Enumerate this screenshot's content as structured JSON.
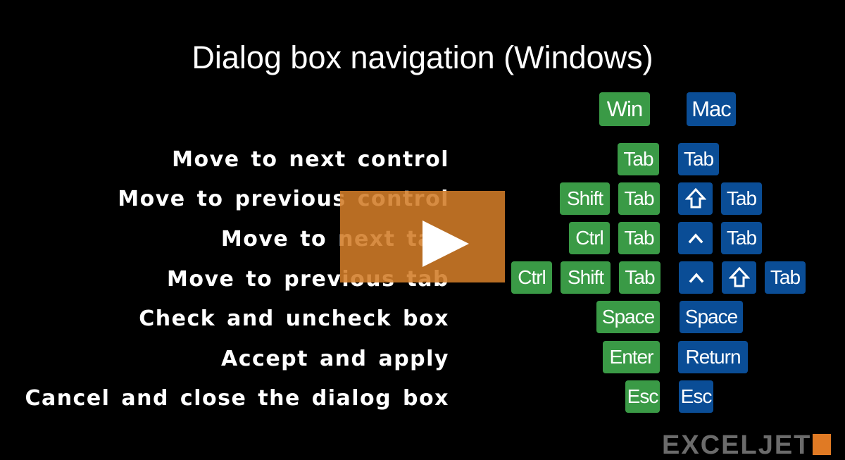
{
  "title": "Dialog box navigation (Windows)",
  "columns": {
    "win_label": "Win",
    "mac_label": "Mac"
  },
  "colors": {
    "win_key": "#3a9a46",
    "mac_key": "#0a4d96",
    "play_overlay": "#d17c28",
    "background": "#000000"
  },
  "rows": [
    {
      "description": "Move to next control",
      "win_keys": [
        "Tab"
      ],
      "mac_keys": [
        "Tab"
      ]
    },
    {
      "description": "Move to previous control",
      "win_keys": [
        "Shift",
        "Tab"
      ],
      "mac_keys": [
        "shift-arrow-icon",
        "Tab"
      ]
    },
    {
      "description": "Move to next tab",
      "win_keys": [
        "Ctrl",
        "Tab"
      ],
      "mac_keys": [
        "control-caret-icon",
        "Tab"
      ]
    },
    {
      "description": "Move to previous tab",
      "win_keys": [
        "Ctrl",
        "Shift",
        "Tab"
      ],
      "mac_keys": [
        "control-caret-icon",
        "shift-arrow-icon",
        "Tab"
      ]
    },
    {
      "description": "Check and uncheck box",
      "win_keys": [
        "Space"
      ],
      "mac_keys": [
        "Space"
      ]
    },
    {
      "description": "Accept and apply",
      "win_keys": [
        "Enter"
      ],
      "mac_keys": [
        "Return"
      ]
    },
    {
      "description": "Cancel and close the dialog box",
      "win_keys": [
        "Esc"
      ],
      "mac_keys": [
        "Esc"
      ]
    }
  ],
  "video": {
    "play_icon": "play-icon"
  },
  "logo": {
    "text": "EXCELJET"
  }
}
